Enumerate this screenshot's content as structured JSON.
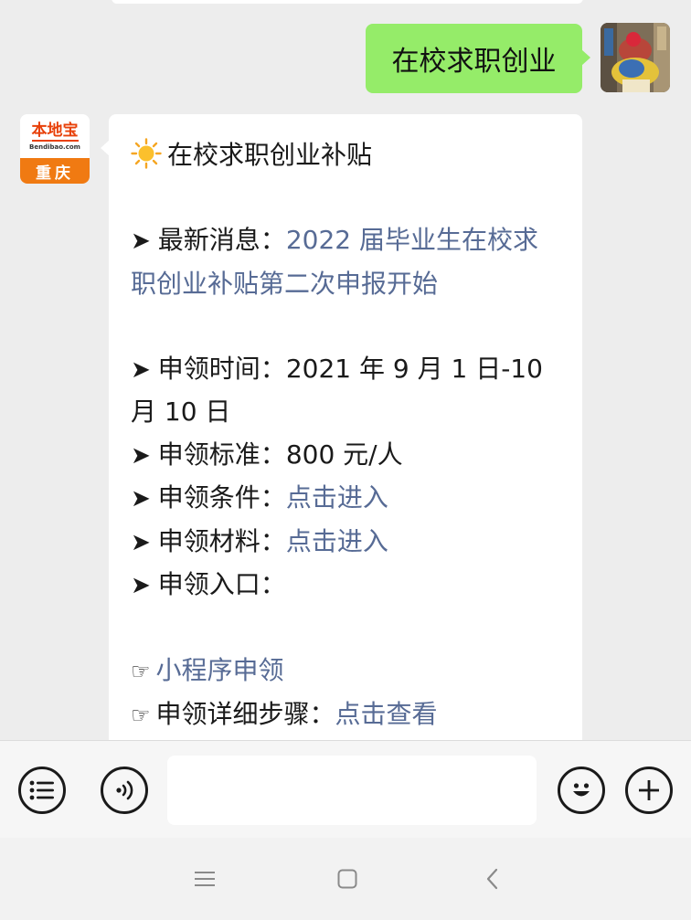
{
  "chat": {
    "outgoing_message": "在校求职创业",
    "incoming": {
      "avatar": {
        "logo_main": "本地宝",
        "logo_sub": "Bendibao.com",
        "city": "重庆"
      },
      "title": "在校求职创业补贴",
      "latest_news_label": "最新消息：",
      "latest_news_link": "2022 届毕业生在校求职创业补贴第二次申报开始",
      "apply_time_label": "申领时间：",
      "apply_time_value_1": "2021 年 9 月 1 日-10",
      "apply_time_value_2": "月 10 日",
      "apply_standard_label": "申领标准：",
      "apply_standard_value": "800 元/人",
      "apply_conditions_label": "申领条件：",
      "apply_conditions_link": "点击进入",
      "apply_materials_label": "申领材料：",
      "apply_materials_link": "点击进入",
      "apply_entry_label": "申领入口：",
      "mini_program_link": "小程序申领",
      "steps_label": "申领详细步骤：",
      "steps_link": "点击查看"
    }
  },
  "icons": {
    "arrow": "➤",
    "hand": "☞",
    "sun": "sun-icon"
  },
  "colors": {
    "outgoing_bubble": "#95ec69",
    "link": "#576b95",
    "background": "#ededed",
    "brand_orange": "#f07a12"
  }
}
